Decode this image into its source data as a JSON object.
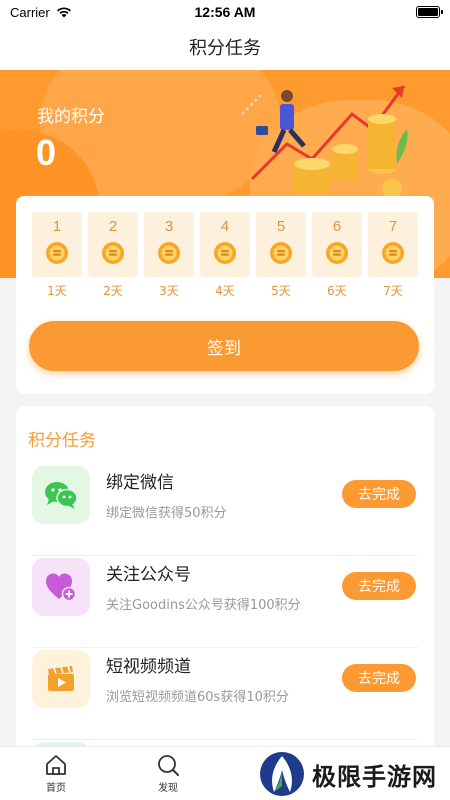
{
  "status_bar": {
    "carrier": "Carrier",
    "time": "12:56 AM"
  },
  "nav": {
    "title": "积分任务"
  },
  "hero": {
    "label": "我的积分",
    "points": "0"
  },
  "checkin": {
    "days": [
      {
        "num": "1",
        "label": "1天"
      },
      {
        "num": "2",
        "label": "2天"
      },
      {
        "num": "3",
        "label": "3天"
      },
      {
        "num": "4",
        "label": "4天"
      },
      {
        "num": "5",
        "label": "5天"
      },
      {
        "num": "6",
        "label": "6天"
      },
      {
        "num": "7",
        "label": "7天"
      }
    ],
    "button_label": "签到"
  },
  "tasks": {
    "title": "积分任务",
    "items": [
      {
        "name": "绑定微信",
        "desc": "绑定微信获得50积分",
        "button": "去完成",
        "icon": "wechat-icon",
        "icon_bg": "#e3f7e4",
        "icon_color": "#3cc551"
      },
      {
        "name": "关注公众号",
        "desc": "关注Goodins公众号获得100积分",
        "button": "去完成",
        "icon": "heart-plus-icon",
        "icon_bg": "#f7e3f9",
        "icon_color": "#c85ad8"
      },
      {
        "name": "短视频频道",
        "desc": "浏览短视频频道60s获得10积分",
        "button": "去完成",
        "icon": "video-clapper-icon",
        "icon_bg": "#fdf3dc",
        "icon_color": "#f2a22c"
      }
    ]
  },
  "tabbar": {
    "items": [
      {
        "label": "首页",
        "icon": "home-icon"
      },
      {
        "label": "发现",
        "icon": "discover-icon"
      }
    ]
  },
  "watermark": {
    "text": "极限手游网"
  },
  "colors": {
    "accent": "#fb9a32",
    "hero_bg": "#ff9a2e",
    "day_bg": "#fdf1de"
  }
}
